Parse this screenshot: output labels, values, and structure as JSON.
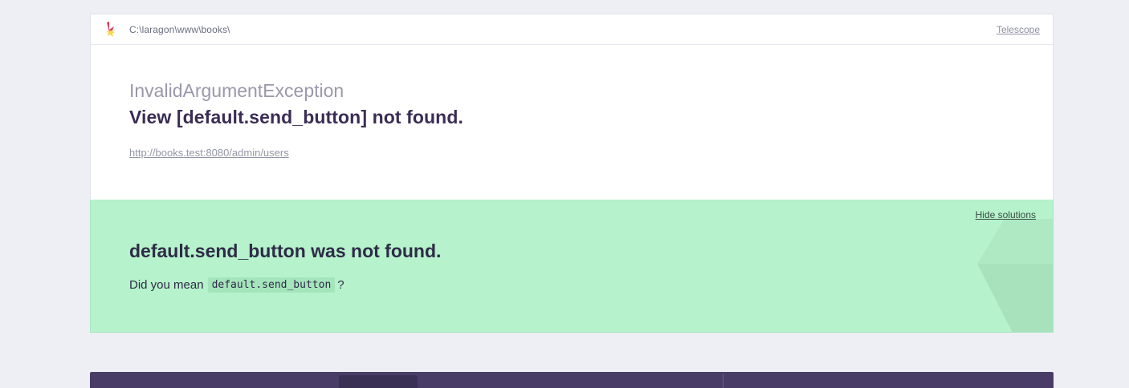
{
  "header": {
    "path": "C:\\laragon\\www\\books\\",
    "telescope_link": "Telescope",
    "logo_icon": "ignition-flame-icon"
  },
  "error": {
    "exception_class": "InvalidArgumentException",
    "message": "View [default.send_button] not found.",
    "url": "http://books.test:8080/admin/users"
  },
  "solution": {
    "hide_label": "Hide solutions",
    "title": "default.send_button was not found.",
    "description_prefix": "Did you mean",
    "suggestion_code": "default.send_button",
    "description_suffix": "?"
  },
  "colors": {
    "page_background": "#eeeff4",
    "solution_background": "#b6f2cb",
    "bottom_bar": "#493c66",
    "logo_red": "#e7385e",
    "logo_yellow": "#f5d84b"
  }
}
